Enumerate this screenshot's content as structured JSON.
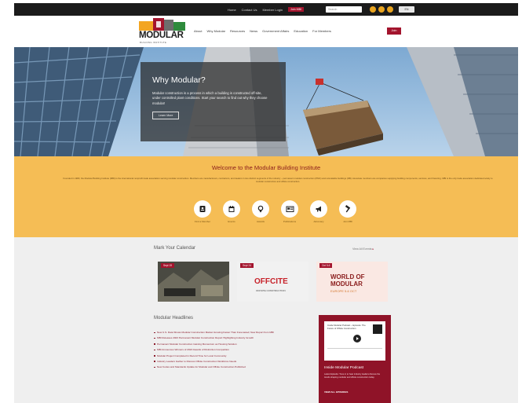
{
  "topbar": {
    "links": [
      "Home",
      "Contact Us",
      "Member Login"
    ],
    "join_label": "Join MBI",
    "search_placeholder": "Search",
    "lang_label": "EN"
  },
  "header": {
    "logo_word": "MODULAR",
    "logo_sub": "BUILDING INSTITUTE",
    "nav": [
      "About",
      "Why Modular",
      "Resources",
      "News",
      "Government Affairs",
      "Education",
      "For Members"
    ],
    "nav_button": "Join"
  },
  "hero": {
    "title": "Why Modular?",
    "text": "Modular construction is a process in which a building is constructed off-site, under controlled plant conditions. Start your search to find out why they choose modular!",
    "button": "Learn More"
  },
  "welcome": {
    "title": "Welcome to the Modular Building Institute",
    "text": "Founded in 1983, the Modular Building Institute (MBI) is the international nonprofit trade association serving modular construction. Members are manufacturers, contractors, and dealers in two distinct segments of the industry – permanent modular construction (PMC) and relocatable buildings (RB). Associate members are companies supplying building components, services, and financing. MBI is the only trade association dedicated solely to modular construction and offsite construction.",
    "icons": [
      {
        "icon": "id-card-icon",
        "label": "Find a Member"
      },
      {
        "icon": "calendar-icon",
        "label": "Events"
      },
      {
        "icon": "award-icon",
        "label": "Awards"
      },
      {
        "icon": "newspaper-icon",
        "label": "Publications"
      },
      {
        "icon": "megaphone-icon",
        "label": "Advocacy"
      },
      {
        "icon": "hammer-icon",
        "label": "Join MBI"
      }
    ]
  },
  "calendar": {
    "title": "Mark Your Calendar",
    "view_all": "View All Events",
    "events": [
      {
        "badge": "Sept 19"
      },
      {
        "badge": "Sept 24",
        "name": "OFFCITE",
        "caption": "OFFSITE CONSTRUCTION"
      },
      {
        "badge": "Oct 5-6",
        "name_line1": "WORLD OF",
        "name_line2": "MODULAR",
        "caption": "EUROPE 5-6 OCT"
      }
    ]
  },
  "headlines": {
    "title": "Modular Headlines",
    "items": [
      "New U.S. Data Shows Modular Construction Market Growing Faster Than Forecasted; New Report from MBI",
      "MBI Releases 2023 Permanent Modular Construction Report Highlighting Industry Growth",
      "Permanent Modular Construction Gaining Momentum as Housing Solution",
      "MBI Announces Winners of 2023 Awards of Distinction Competition",
      "Modular Project Completed in Record Time for Local Community",
      "Industry Leaders Gather to Discuss Offsite Construction Workforce Needs",
      "New Codes and Standards Update for Modular and Offsite Construction Published"
    ]
  },
  "podcast": {
    "player_title": "Inside Modular Podcast – Episode: The Future of Offsite Construction",
    "title": "Inside Modular Podcast",
    "text": "Latest Episode: Tune in to hear industry leaders discuss the trends shaping modular and offsite construction today.",
    "more": "VIEW ALL EPISODES"
  },
  "colors": {
    "accent": "#a3142d",
    "welcome_band": "#f5bd55",
    "podcast_bg": "#8f1328"
  }
}
